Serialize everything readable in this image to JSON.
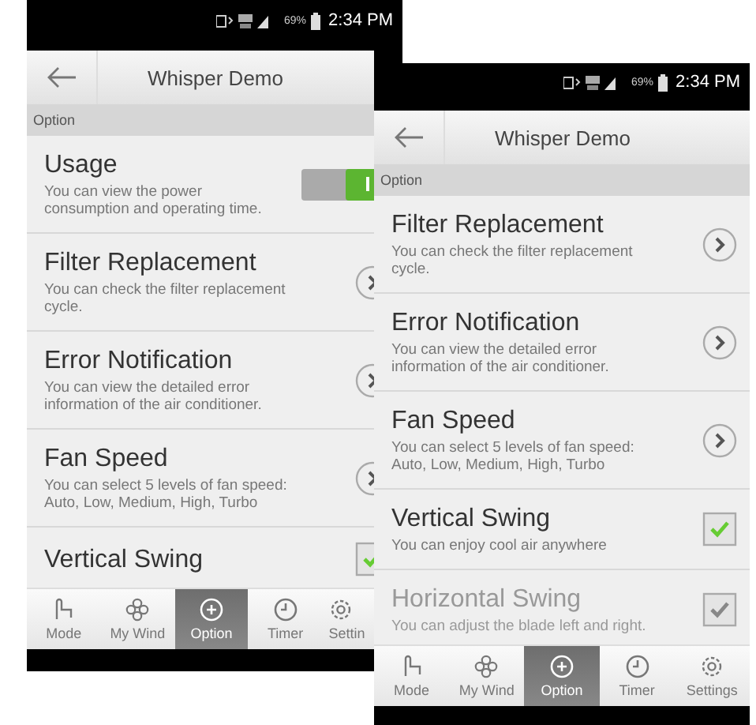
{
  "phones": [
    {
      "status_bar": {
        "battery": "69%",
        "time": "2:34 PM"
      },
      "title": "Whisper Demo",
      "section": "Option",
      "rows": [
        {
          "kind": "toggle",
          "title": "Usage",
          "description": "You can view the power consumption and operating time.",
          "on": true,
          "disabled": false
        },
        {
          "kind": "link",
          "title": "Filter Replacement",
          "description": "You can check the filter replacement cycle.",
          "disabled": false
        },
        {
          "kind": "link",
          "title": "Error Notification",
          "description": "You can view the detailed error information of the air conditioner.",
          "disabled": false
        },
        {
          "kind": "link",
          "title": "Fan Speed",
          "description": "You can select 5 levels of fan speed: Auto, Low, Medium, High, Turbo",
          "disabled": false
        },
        {
          "kind": "checkbox",
          "title": "Vertical Swing",
          "checked": true,
          "disabled": false
        }
      ],
      "tabs": [
        {
          "label": "Mode",
          "selected": false
        },
        {
          "label": "My Wind",
          "selected": false
        },
        {
          "label": "Option",
          "selected": true
        },
        {
          "label": "Timer",
          "selected": false
        },
        {
          "label": "Settin",
          "selected": false
        }
      ]
    },
    {
      "status_bar": {
        "battery": "69%",
        "time": "2:34 PM"
      },
      "title": "Whisper Demo",
      "section": "Option",
      "rows": [
        {
          "kind": "link",
          "title": "Filter Replacement",
          "description": "You can check the filter replacement cycle.",
          "disabled": false
        },
        {
          "kind": "link",
          "title": "Error Notification",
          "description": "You can view the detailed error information of the air conditioner.",
          "disabled": false
        },
        {
          "kind": "link",
          "title": "Fan Speed",
          "description": "You can select 5 levels of fan speed: Auto, Low, Medium, High, Turbo",
          "disabled": false
        },
        {
          "kind": "checkbox",
          "title": "Vertical Swing",
          "description": "You can enjoy cool air anywhere",
          "checked": true,
          "disabled": false
        },
        {
          "kind": "checkbox",
          "title": "Horizontal Swing",
          "description": "You can adjust the blade left and right.",
          "checked": true,
          "disabled": true
        }
      ],
      "tabs": [
        {
          "label": "Mode",
          "selected": false
        },
        {
          "label": "My Wind",
          "selected": false
        },
        {
          "label": "Option",
          "selected": true
        },
        {
          "label": "Timer",
          "selected": false
        },
        {
          "label": "Settings",
          "selected": false
        }
      ]
    }
  ]
}
